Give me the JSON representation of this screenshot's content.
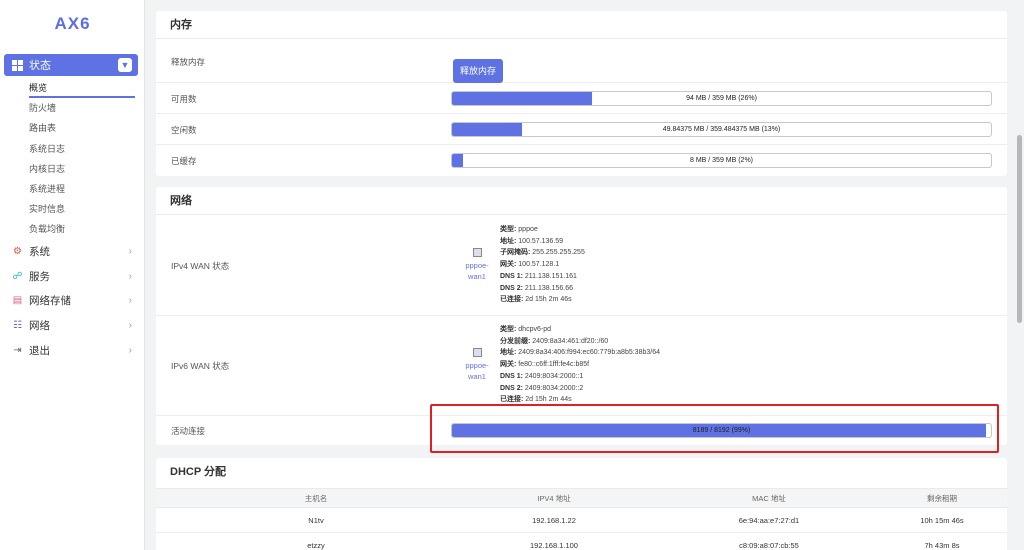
{
  "sidebar": {
    "logo": "AX6",
    "active_menu": "状态",
    "sub_items": [
      "概览",
      "防火墙",
      "路由表",
      "系统日志",
      "内核日志",
      "系统进程",
      "实时信息",
      "负载均衡"
    ],
    "groups": [
      {
        "label": "系统",
        "icon": "gear-icon"
      },
      {
        "label": "服务",
        "icon": "share-icon"
      },
      {
        "label": "网络存储",
        "icon": "database-icon"
      },
      {
        "label": "网络",
        "icon": "network-icon"
      },
      {
        "label": "退出",
        "icon": "logout-icon"
      }
    ]
  },
  "memory": {
    "title": "内存",
    "release_label": "释放内存",
    "release_button": "释放内存",
    "rows": [
      {
        "label": "可用数",
        "text": "94 MB / 359 MB (26%)",
        "percent": 26
      },
      {
        "label": "空闲数",
        "text": "49.84375 MB / 359.484375 MB (13%)",
        "percent": 13
      },
      {
        "label": "已缓存",
        "text": "8 MB / 359 MB (2%)",
        "percent": 2
      }
    ]
  },
  "network": {
    "title": "网络",
    "ipv4": {
      "label": "IPv4 WAN 状态",
      "iface_line1": "pppoe-",
      "iface_line2": "wan1",
      "fields": [
        {
          "k": "类型:",
          "v": " pppoe"
        },
        {
          "k": "地址:",
          "v": " 100.57.136.59"
        },
        {
          "k": "子网掩码:",
          "v": " 255.255.255.255"
        },
        {
          "k": "网关:",
          "v": " 100.57.128.1"
        },
        {
          "k": "DNS 1:",
          "v": " 211.138.151.161"
        },
        {
          "k": "DNS 2:",
          "v": " 211.138.156.66"
        },
        {
          "k": "已连接:",
          "v": " 2d 15h 2m 46s"
        }
      ]
    },
    "ipv6": {
      "label": "IPv6 WAN 状态",
      "iface_line1": "pppoe-",
      "iface_line2": "wan1",
      "fields": [
        {
          "k": "类型:",
          "v": " dhcpv6-pd"
        },
        {
          "k": "分发前缀:",
          "v": " 2409:8a34:461:df20::/60"
        },
        {
          "k": "地址:",
          "v": " 2409:8a34:406:f994:ec60:779b:a8b5:38b3/64"
        },
        {
          "k": "网关:",
          "v": " fe80::c6ff:1fff:fe4c:b85f"
        },
        {
          "k": "DNS 1:",
          "v": " 2409:8034:2000::1"
        },
        {
          "k": "DNS 2:",
          "v": " 2409:8034:2000::2"
        },
        {
          "k": "已连接:",
          "v": " 2d 15h 2m 44s"
        }
      ]
    },
    "connections": {
      "label": "活动连接",
      "text": "8189 / 8192 (99%)",
      "percent": 99
    }
  },
  "dhcp": {
    "title": "DHCP 分配",
    "columns": [
      "主机名",
      "IPV4 地址",
      "MAC 地址",
      "剩余租期"
    ],
    "rows": [
      [
        "N1tv",
        "192.168.1.22",
        "6e:94:aa:e7:27:d1",
        "10h 15m 46s"
      ],
      [
        "etzzy",
        "192.168.1.100",
        "c8:09:a8:07:cb:55",
        "7h 43m 8s"
      ]
    ]
  },
  "colors": {
    "accent": "#5e72e4",
    "highlight": "#e02020"
  }
}
